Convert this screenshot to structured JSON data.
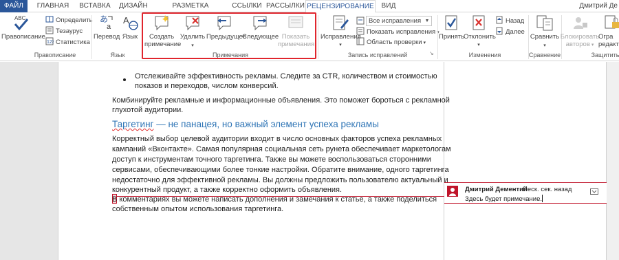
{
  "tabs": [
    "ФАЙЛ",
    "ГЛАВНАЯ",
    "ВСТАВКА",
    "ДИЗАЙН",
    "РАЗМЕТКА СТРАНИЦЫ",
    "ССЫЛКИ",
    "РАССЫЛКИ",
    "РЕЦЕНЗИРОВАНИЕ",
    "ВИД"
  ],
  "user_name": "Дмитрий Де",
  "ribbon": {
    "proofing": {
      "spelling_label": "Правописание",
      "abc_label": "ABC",
      "define_label": "Определить",
      "thesaurus_label": "Тезаурус",
      "stats_label": "Статистика",
      "group_label": "Правописание"
    },
    "language": {
      "translate_label": "Перевод",
      "language_label": "Язык",
      "group_label": "Язык"
    },
    "comments": {
      "new_label_1": "Создать",
      "new_label_2": "примечание",
      "delete_label": "Удалить",
      "previous_label": "Предыдущее",
      "next_label": "Следующее",
      "show_label_1": "Показать",
      "show_label_2": "примечания",
      "group_label": "Примечания"
    },
    "tracking": {
      "track_label": "Исправления",
      "markup_select": "Все исправления",
      "show_markup_label": "Показать исправления",
      "pane_label": "Область проверки",
      "group_label": "Запись исправлений"
    },
    "changes": {
      "accept_label": "Принять",
      "reject_label": "Отклонить",
      "prev_label": "Назад",
      "next_label": "Далее",
      "group_label": "Изменения"
    },
    "compare": {
      "compare_label": "Сравнить",
      "group_label": "Сравнение"
    },
    "protect": {
      "block_label_1": "Блокировать",
      "block_label_2": "авторов",
      "restrict_label_1": "Огра",
      "restrict_label_2": "редакти",
      "group_label": "Защитить"
    }
  },
  "document": {
    "bullet_line_1": "Отслеживайте эффективность рекламы. Следите за CTR, количеством и стоимостью",
    "bullet_line_2": "показов и переходов, числом конверсий.",
    "para1_line_1": "Комбинируйте рекламные и информационные объявления. Это поможет бороться с рекламной",
    "para1_line_2": "глухотой аудитории.",
    "heading_word": "Таргетинг",
    "heading_rest": " — не панацея, но важный элемент успеха рекламы",
    "para2_lines": [
      "Корректный выбор целевой аудитории входит в число основных факторов успеха рекламных",
      "кампаний «Вконтакте». Самая популярная социальная сеть рунета обеспечивает маркетологам",
      "доступ к инструментам точного таргетинга. Также вы можете воспользоваться сторонними",
      "сервисами, обеспечивающими более тонкие настройки. Обратите внимание, одного таргетинга",
      "недостаточно для эффективной рекламы. Вы должны предложить пользователю актуальный и",
      "конкурентный продукт, а также корректно оформить объявления."
    ],
    "para3_first_letter": "В",
    "para3_line_1_rest": " комментариях вы можете написать дополнения и замечания к статье, а также поделиться",
    "para3_line_2": "собственным опытом использования таргетинга."
  },
  "comment": {
    "author": "Дмитрий Дементий",
    "time": "Неск. сек. назад",
    "text": "Здесь будет примечание."
  },
  "colors": {
    "file_tab": "#2b579a",
    "heading": "#2e74b5",
    "comment_accent": "#c0142a",
    "highlight_box": "#e0252d"
  }
}
